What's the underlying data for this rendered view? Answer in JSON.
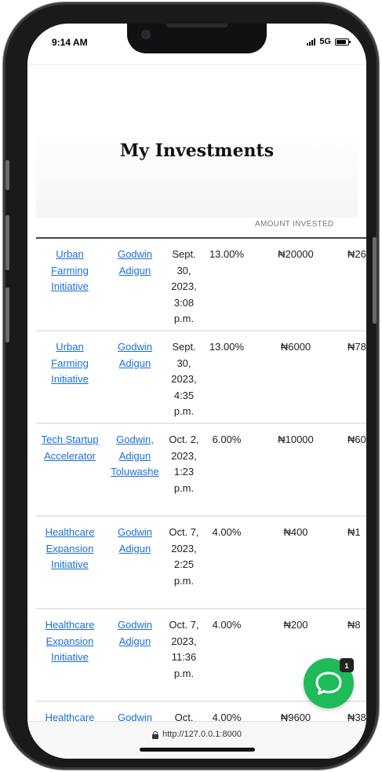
{
  "status_bar": {
    "time": "9:14 AM",
    "network": "5G"
  },
  "page": {
    "title": "My Investments",
    "column_header": "AMOUNT INVESTED"
  },
  "investments": [
    {
      "name": "Urban Farming Initiative",
      "owner": "Godwin Adigun",
      "date": "Sept. 30, 2023, 3:08 p.m.",
      "rate": "13.00%",
      "amount": "₦20000",
      "return": "₦26"
    },
    {
      "name": "Urban Farming Initiative",
      "owner": "Godwin Adigun",
      "date": "Sept. 30, 2023, 4:35 p.m.",
      "rate": "13.00%",
      "amount": "₦6000",
      "return": "₦78"
    },
    {
      "name": "Tech Startup Accelerator",
      "owner": "Godwin, Adigun Toluwashe",
      "date": "Oct. 2, 2023, 1:23 p.m.",
      "rate": "6.00%",
      "amount": "₦10000",
      "return": "₦60"
    },
    {
      "name": "Healthcare Expansion Initiative",
      "owner": "Godwin Adigun",
      "date": "Oct. 7, 2023, 2:25 p.m.",
      "rate": "4.00%",
      "amount": "₦400",
      "return": "₦1"
    },
    {
      "name": "Healthcare Expansion Initiative",
      "owner": "Godwin Adigun",
      "date": "Oct. 7, 2023, 11:36 p.m.",
      "rate": "4.00%",
      "amount": "₦200",
      "return": "₦8"
    },
    {
      "name": "Healthcare",
      "owner": "Godwin",
      "date": "Oct.",
      "rate": "4.00%",
      "amount": "₦9600",
      "return": "₦38"
    }
  ],
  "browser": {
    "url": "http://127.0.0.1:8000"
  },
  "chat": {
    "badge_count": "1",
    "icon": "chat-bubble-icon",
    "color": "#1fba5a"
  }
}
